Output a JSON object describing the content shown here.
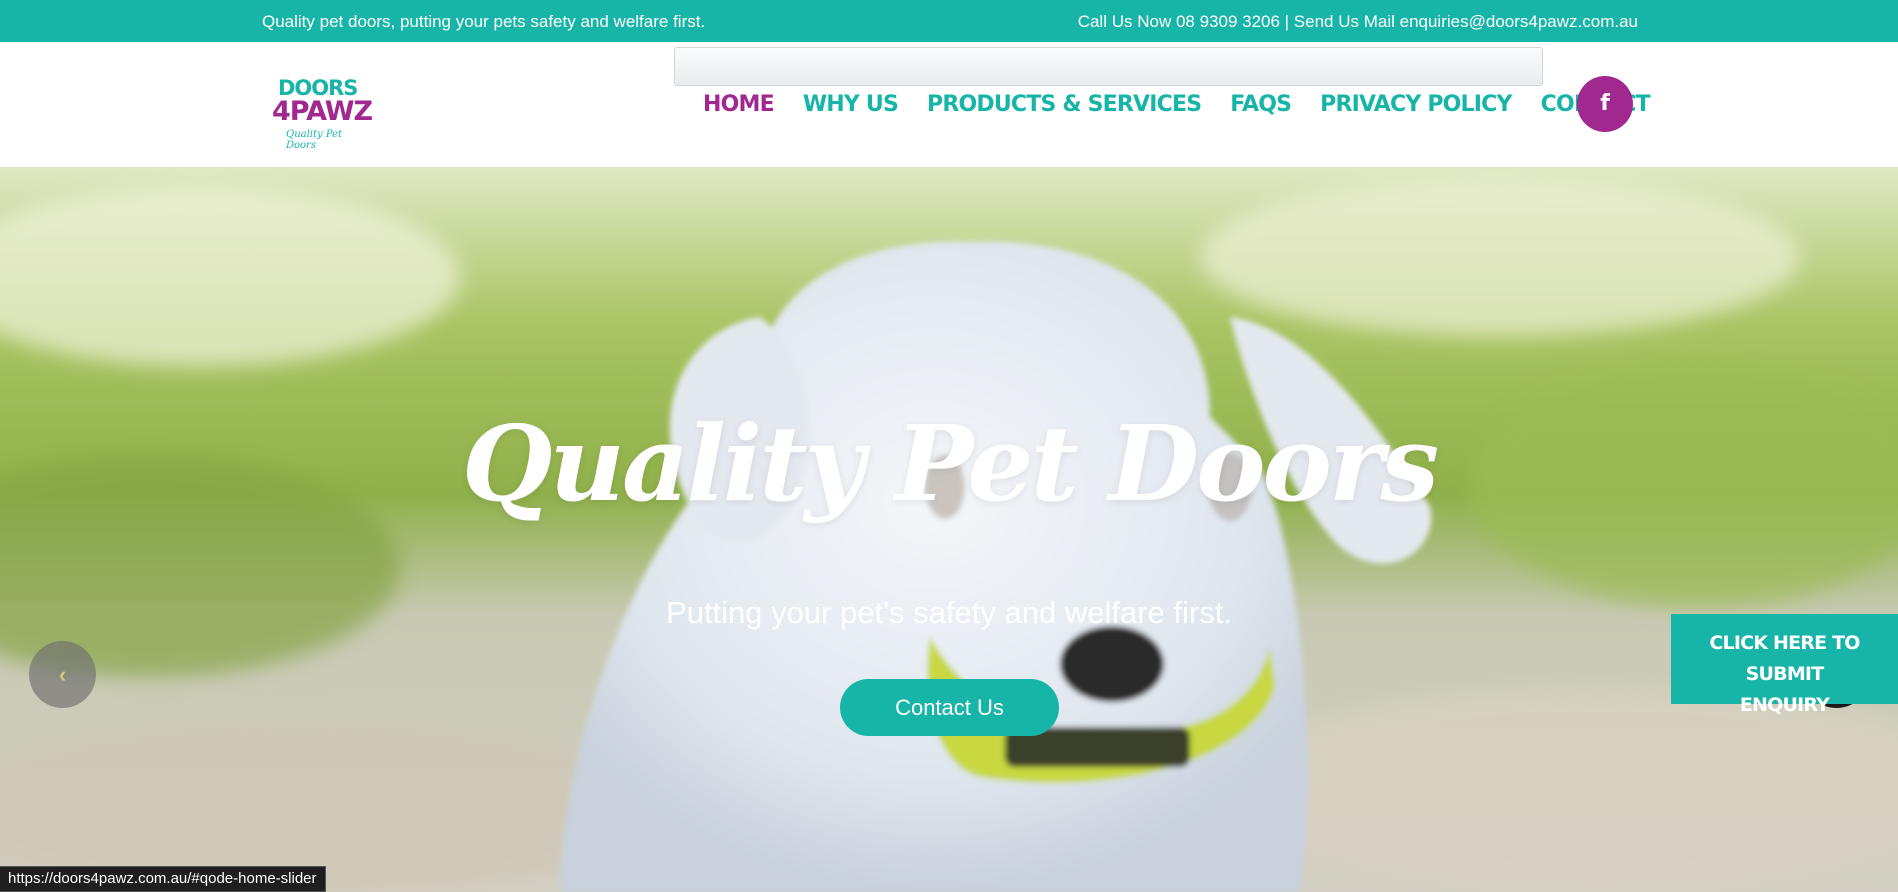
{
  "topbar": {
    "tagline": "Quality pet doors, putting your pets safety and welfare first.",
    "contact_line": "Call Us Now 08 9309 3206 | Send Us Mail enquiries@doors4pawz.com.au"
  },
  "logo": {
    "line1": "DOORS",
    "line2": "4PAWZ",
    "tagline": "Quality Pet Doors"
  },
  "nav": {
    "items": [
      {
        "label": "HOME",
        "active": true
      },
      {
        "label": "WHY US"
      },
      {
        "label": "PRODUCTS & SERVICES"
      },
      {
        "label": "FAQS"
      },
      {
        "label": "PRIVACY POLICY"
      },
      {
        "label": "CONTACT"
      }
    ]
  },
  "social": {
    "facebook_glyph": "f",
    "facebook_icon": "facebook-icon"
  },
  "hero": {
    "title": "Quality Pet Doors",
    "subtitle": "Putting your pet's safety and welfare first.",
    "cta_label": "Contact Us",
    "prev_glyph": "‹",
    "next_glyph": "›"
  },
  "enquiry": {
    "line1": "CLICK HERE TO SUBMIT",
    "line2": "ENQUIRY"
  },
  "status_bar": {
    "url": "https://doors4pawz.com.au/#qode-home-slider"
  },
  "colors": {
    "teal": "#16b5a8",
    "purple": "#a0288f",
    "next_arrow_bg": "#1b1b1b",
    "arrow_glyph": "#f1d340"
  }
}
